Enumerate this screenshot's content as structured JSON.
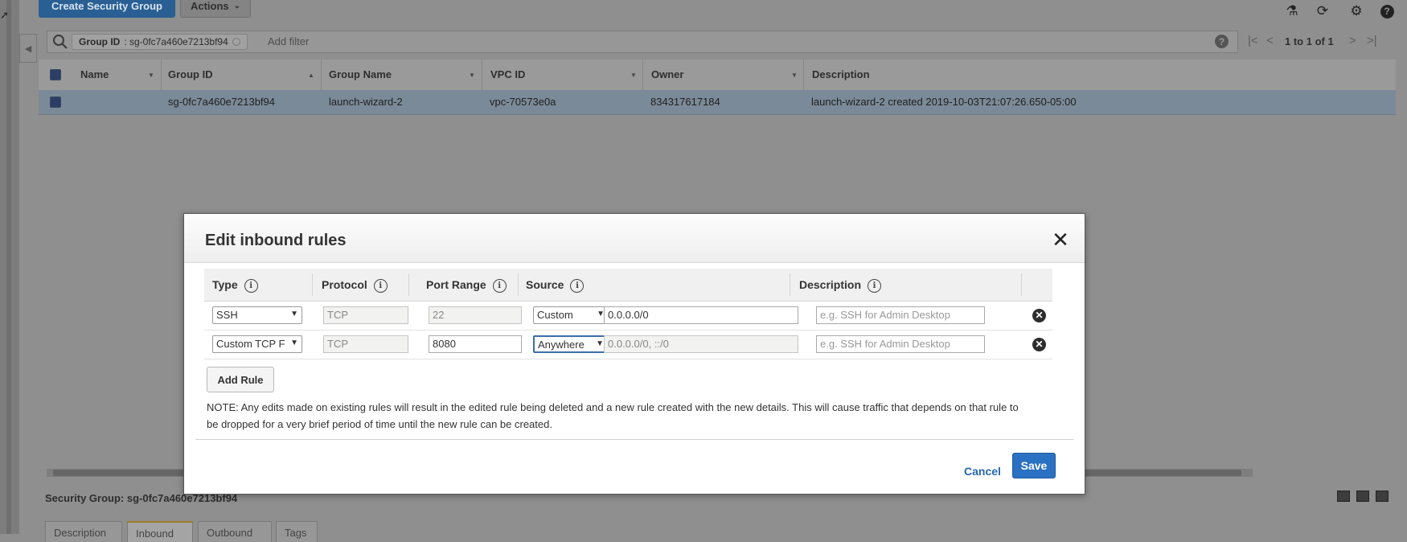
{
  "toolbar": {
    "create_label": "Create Security Group",
    "actions_label": "Actions",
    "icons": [
      "flask-icon",
      "refresh-icon",
      "gear-icon",
      "help-icon"
    ]
  },
  "filter": {
    "chip_key": "Group ID",
    "chip_value": ": sg-0fc7a460e7213bf94",
    "add_filter": "Add filter",
    "pager_text": "1 to 1 of 1"
  },
  "table": {
    "columns": [
      "Name",
      "Group ID",
      "Group Name",
      "VPC ID",
      "Owner",
      "Description"
    ],
    "row": {
      "name": "",
      "group_id": "sg-0fc7a460e7213bf94",
      "group_name": "launch-wizard-2",
      "vpc_id": "vpc-70573e0a",
      "owner": "834317617184",
      "description": "launch-wizard-2 created 2019-10-03T21:07:26.650-05:00"
    }
  },
  "bottom": {
    "label": "Security Group: sg-0fc7a460e7213bf94",
    "tabs": [
      "Description",
      "Inbound",
      "Outbound",
      "Tags"
    ]
  },
  "modal": {
    "title": "Edit inbound rules",
    "headers": {
      "type": "Type",
      "protocol": "Protocol",
      "port_range": "Port Range",
      "source": "Source",
      "description": "Description"
    },
    "rules": [
      {
        "type": "SSH",
        "protocol": "TCP",
        "port_range": "22",
        "source_type": "Custom",
        "source_value": "0.0.0.0/0",
        "description_placeholder": "e.g. SSH for Admin Desktop"
      },
      {
        "type": "Custom TCP F",
        "protocol": "TCP",
        "port_range": "8080",
        "source_type": "Anywhere",
        "source_value": "0.0.0.0/0, ::/0",
        "description_placeholder": "e.g. SSH for Admin Desktop"
      }
    ],
    "add_rule": "Add Rule",
    "note": "NOTE: Any edits made on existing rules will result in the edited rule being deleted and a new rule created with the new details. This will cause traffic that depends on that rule to be dropped for a very brief period of time until the new rule can be created.",
    "cancel": "Cancel",
    "save": "Save"
  },
  "colors": {
    "primary_button": "#2b71c3",
    "cancel_link": "#2567b3",
    "overlay": "#8f8f8f"
  }
}
